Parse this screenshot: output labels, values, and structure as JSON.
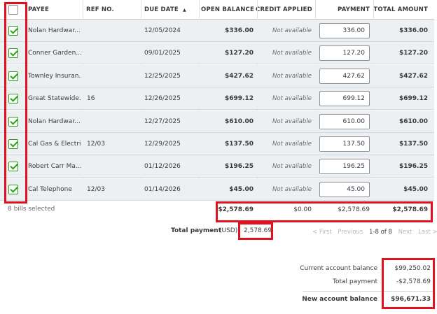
{
  "columns": {
    "payee": "PAYEE",
    "ref_no": "REF NO.",
    "due_date": "DUE DATE",
    "sort_arrow": "▲",
    "open_balance": "OPEN BALANCE",
    "credit_applied": "CREDIT APPLIED",
    "payment": "PAYMENT",
    "total_amount": "TOTAL AMOUNT"
  },
  "rows": [
    {
      "checked": true,
      "payee": "Nolan Hardwar...",
      "ref": "",
      "due": "12/05/2024",
      "open": "$336.00",
      "credit": "Not available",
      "payment": "336.00",
      "total": "$336.00"
    },
    {
      "checked": true,
      "payee": "Conner Garden...",
      "ref": "",
      "due": "09/01/2025",
      "open": "$127.20",
      "credit": "Not available",
      "payment": "127.20",
      "total": "$127.20"
    },
    {
      "checked": true,
      "payee": "Townley Insuran...",
      "ref": "",
      "due": "12/25/2025",
      "open": "$427.62",
      "credit": "Not available",
      "payment": "427.62",
      "total": "$427.62"
    },
    {
      "checked": true,
      "payee": "Great Statewide...",
      "ref": "16",
      "due": "12/26/2025",
      "open": "$699.12",
      "credit": "Not available",
      "payment": "699.12",
      "total": "$699.12"
    },
    {
      "checked": true,
      "payee": "Nolan Hardwar...",
      "ref": "",
      "due": "12/27/2025",
      "open": "$610.00",
      "credit": "Not available",
      "payment": "610.00",
      "total": "$610.00"
    },
    {
      "checked": true,
      "payee": "Cal Gas & Electric",
      "ref": "12/03",
      "due": "12/29/2025",
      "open": "$137.50",
      "credit": "Not available",
      "payment": "137.50",
      "total": "$137.50"
    },
    {
      "checked": true,
      "payee": "Robert Carr Ma...",
      "ref": "",
      "due": "01/12/2026",
      "open": "$196.25",
      "credit": "Not available",
      "payment": "196.25",
      "total": "$196.25"
    },
    {
      "checked": true,
      "payee": "Cal Telephone",
      "ref": "12/03",
      "due": "01/14/2026",
      "open": "$45.00",
      "credit": "Not available",
      "payment": "45.00",
      "total": "$45.00"
    }
  ],
  "totals": {
    "selected_text": "8 bills selected",
    "open": "$2,578.69",
    "credit": "$0.00",
    "payment": "$2,578.69",
    "total": "$2,578.69"
  },
  "total_payment": {
    "label": "Total payment",
    "currency": "(USD)",
    "value": "2,578.69"
  },
  "pager": {
    "first": "< First",
    "previous": "Previous",
    "range": "1-8 of 8",
    "next": "Next",
    "last": "Last >"
  },
  "summary": {
    "current_label": "Current account balance",
    "current_value": "$99,250.02",
    "payment_label": "Total payment",
    "payment_value": "-$2,578.69",
    "new_label": "New account balance",
    "new_value": "$96,671.33"
  },
  "colors": {
    "highlight": "#e0121f",
    "check": "#2ca01c",
    "row_bg": "#ecf0f3"
  }
}
